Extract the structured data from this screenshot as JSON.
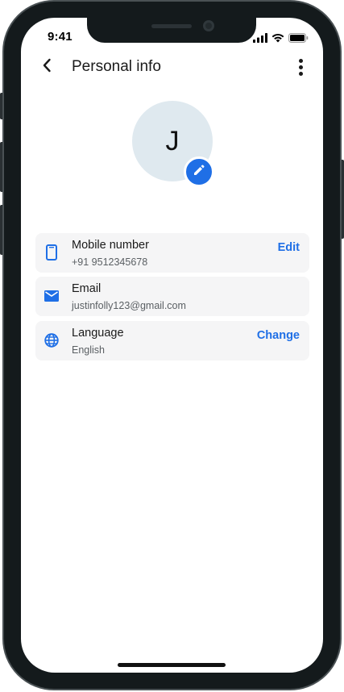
{
  "status_bar": {
    "time": "9:41",
    "icons": [
      "signal-icon",
      "wifi-icon",
      "battery-icon"
    ]
  },
  "app_bar": {
    "title": "Personal info",
    "back_icon": "chevron-left-icon",
    "more_icon": "more-vertical-icon"
  },
  "profile": {
    "initial": "J",
    "edit_icon": "pencil-icon"
  },
  "info_items": [
    {
      "icon": "phone-icon",
      "title": "Mobile number",
      "value": "+91 9512345678",
      "action": "Edit"
    },
    {
      "icon": "email-icon",
      "title": "Email",
      "value": "justinfolly123@gmail.com",
      "action": ""
    },
    {
      "icon": "globe-icon",
      "title": "Language",
      "value": "English",
      "action": "Change"
    }
  ],
  "colors": {
    "accent": "#1f6fe6",
    "avatar_bg": "#dfe9ef",
    "card_bg": "#f5f5f6"
  }
}
